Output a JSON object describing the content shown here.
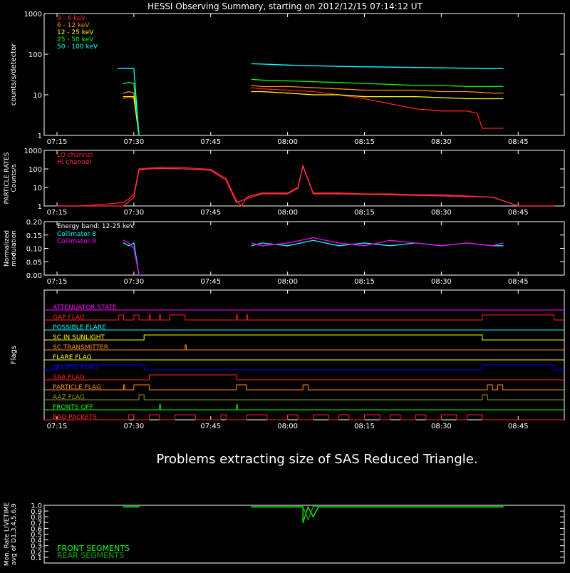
{
  "title": "HESSI Observing Summary, starting on 2012/12/15 07:14:12 UT",
  "time_ticks": [
    "07:15",
    "07:30",
    "07:45",
    "08:00",
    "08:15",
    "08:30",
    "08:45"
  ],
  "colors": {
    "band_3_6": "#ff2020",
    "band_6_12": "#ff8c00",
    "band_12_25": "#ffff00",
    "band_25_50": "#00ff00",
    "band_50_100": "#00ffff",
    "lo_channel": "#ff2020",
    "hi_channel": "#ff3050",
    "collimator_8": "#00ffff",
    "collimator_9": "#ff00ff",
    "front": "#00ff00",
    "rear": "#00aa00"
  },
  "message": "Problems extracting size of SAS Reduced Triangle.",
  "chart_data": [
    {
      "type": "line",
      "panel": "count-rates",
      "ylabel": "counts/s/detector",
      "yscale": "log",
      "ylim": [
        1,
        1000
      ],
      "y_ticks": [
        "1",
        "10",
        "100",
        "1000"
      ],
      "x_ticks": [
        "07:15",
        "07:30",
        "07:45",
        "08:00",
        "08:15",
        "08:30",
        "08:45"
      ],
      "legend": "top-left",
      "series": [
        {
          "name": "3 - 6 keV",
          "color": "#ff2020",
          "segments": [
            {
              "t": [
                "07:28",
                "07:29",
                "07:30",
                "07:31"
              ],
              "v": [
                8,
                9,
                8,
                1
              ]
            },
            {
              "t": [
                "07:53",
                "07:55",
                "08:00",
                "08:05",
                "08:10",
                "08:15",
                "08:20",
                "08:25",
                "08:30",
                "08:35",
                "08:37",
                "08:38",
                "08:42"
              ],
              "v": [
                15,
                14,
                13,
                12,
                10,
                8,
                6,
                4.5,
                4,
                4,
                3.5,
                1.5,
                1.5
              ]
            }
          ]
        },
        {
          "name": "6 - 12 keV",
          "color": "#ff8c00",
          "segments": [
            {
              "t": [
                "07:28",
                "07:29",
                "07:30",
                "07:31"
              ],
              "v": [
                11,
                12,
                11,
                1
              ]
            },
            {
              "t": [
                "07:53",
                "07:55",
                "08:00",
                "08:05",
                "08:10",
                "08:15",
                "08:20",
                "08:25",
                "08:30",
                "08:35",
                "08:40",
                "08:42"
              ],
              "v": [
                17,
                16,
                16,
                15,
                14,
                13,
                13,
                13,
                12,
                12,
                11,
                11
              ]
            }
          ]
        },
        {
          "name": "12 - 25 keV",
          "color": "#ffff00",
          "segments": [
            {
              "t": [
                "07:28",
                "07:29",
                "07:30",
                "07:31"
              ],
              "v": [
                9,
                9,
                9,
                1
              ]
            },
            {
              "t": [
                "07:53",
                "07:55",
                "08:00",
                "08:05",
                "08:10",
                "08:15",
                "08:20",
                "08:25",
                "08:30",
                "08:35",
                "08:40",
                "08:42"
              ],
              "v": [
                12,
                12,
                11,
                10,
                10,
                9,
                9,
                9,
                8.5,
                8,
                8,
                8
              ]
            }
          ]
        },
        {
          "name": "25 - 50 keV",
          "color": "#00ff00",
          "segments": [
            {
              "t": [
                "07:28",
                "07:29",
                "07:30",
                "07:31"
              ],
              "v": [
                19,
                20,
                19,
                1
              ]
            },
            {
              "t": [
                "07:53",
                "07:55",
                "08:00",
                "08:05",
                "08:10",
                "08:15",
                "08:20",
                "08:25",
                "08:30",
                "08:35",
                "08:40",
                "08:42"
              ],
              "v": [
                24,
                23,
                22,
                21,
                20,
                19,
                18,
                17,
                17,
                16,
                16,
                16
              ]
            }
          ]
        },
        {
          "name": "50 - 100 keV",
          "color": "#00ffff",
          "segments": [
            {
              "t": [
                "07:27",
                "07:28",
                "07:30",
                "07:31"
              ],
              "v": [
                44,
                45,
                44,
                1
              ]
            },
            {
              "t": [
                "07:53",
                "07:55",
                "08:00",
                "08:05",
                "08:10",
                "08:15",
                "08:20",
                "08:25",
                "08:30",
                "08:35",
                "08:40",
                "08:42"
              ],
              "v": [
                58,
                57,
                54,
                52,
                50,
                49,
                48,
                47,
                46,
                45,
                44,
                44
              ]
            }
          ]
        }
      ]
    },
    {
      "type": "line",
      "panel": "particle-rates",
      "ylabel": "PARTICLE RATES Counts/s",
      "yscale": "log",
      "ylim": [
        1,
        1000
      ],
      "y_ticks": [
        "1",
        "10",
        "100",
        "1000"
      ],
      "x_ticks": [
        "07:15",
        "07:30",
        "07:45",
        "08:00",
        "08:15",
        "08:30",
        "08:45"
      ],
      "legend": "top-left",
      "series": [
        {
          "name": "LO channel",
          "color": "#ff2020",
          "t": [
            "07:15",
            "07:20",
            "07:28",
            "07:30",
            "07:31",
            "07:33",
            "07:35",
            "07:40",
            "07:45",
            "07:48",
            "07:50",
            "07:51",
            "07:52",
            "07:55",
            "08:00",
            "08:02",
            "08:03",
            "08:05",
            "08:10",
            "08:15",
            "08:20",
            "08:25",
            "08:30",
            "08:35",
            "08:40",
            "08:45",
            "08:52"
          ],
          "v": [
            1,
            1,
            1.5,
            4,
            100,
            110,
            120,
            115,
            95,
            30,
            2,
            1,
            3,
            5,
            5,
            10,
            150,
            5,
            5,
            4.5,
            4.5,
            4,
            4,
            3.5,
            3,
            1,
            1
          ]
        },
        {
          "name": "HI channel",
          "color": "#ff3050",
          "t": [
            "07:15",
            "07:28",
            "07:30",
            "07:31",
            "07:33",
            "07:35",
            "07:40",
            "07:45",
            "07:48",
            "07:50",
            "07:52",
            "07:55",
            "08:00",
            "08:02",
            "08:03",
            "08:05",
            "08:10",
            "08:20",
            "08:30",
            "08:40",
            "08:45",
            "08:52"
          ],
          "v": [
            1,
            1,
            3,
            90,
            100,
            105,
            100,
            85,
            25,
            1.5,
            2.5,
            4.5,
            4.5,
            9,
            140,
            4.5,
            4.5,
            4,
            3.5,
            3,
            1,
            1
          ]
        }
      ]
    },
    {
      "type": "line",
      "panel": "modulation",
      "ylabel": "Normalized modulation",
      "annotation": "Energy band: 12-25 keV",
      "ylim": [
        0,
        0.2
      ],
      "y_ticks": [
        "0.00",
        "0.05",
        "0.10",
        "0.15",
        "0.20"
      ],
      "x_ticks": [
        "07:15",
        "07:30",
        "07:45",
        "08:00",
        "08:15",
        "08:30",
        "08:45"
      ],
      "legend": "top-left",
      "series": [
        {
          "name": "Collimator 8",
          "color": "#00ffff",
          "segments": [
            {
              "t": [
                "07:28",
                "07:29",
                "07:30",
                "07:31"
              ],
              "v": [
                0.12,
                0.11,
                0.12,
                0.0
              ]
            },
            {
              "t": [
                "07:53",
                "07:55",
                "08:00",
                "08:05",
                "08:10",
                "08:15",
                "08:20",
                "08:25",
                "08:30",
                "08:35",
                "08:40",
                "08:42"
              ],
              "v": [
                0.11,
                0.12,
                0.11,
                0.13,
                0.11,
                0.12,
                0.11,
                0.12,
                0.11,
                0.12,
                0.11,
                0.11
              ]
            }
          ]
        },
        {
          "name": "Collimator 9",
          "color": "#ff00ff",
          "segments": [
            {
              "t": [
                "07:28",
                "07:29",
                "07:30",
                "07:31"
              ],
              "v": [
                0.13,
                0.12,
                0.1,
                0.0
              ]
            },
            {
              "t": [
                "07:53",
                "07:55",
                "08:00",
                "08:05",
                "08:10",
                "08:15",
                "08:20",
                "08:25",
                "08:30",
                "08:35",
                "08:40",
                "08:42"
              ],
              "v": [
                0.12,
                0.11,
                0.12,
                0.14,
                0.12,
                0.11,
                0.13,
                0.12,
                0.11,
                0.12,
                0.11,
                0.12
              ]
            }
          ]
        }
      ]
    },
    {
      "type": "line",
      "panel": "flags",
      "ylabel": "Flags",
      "x_ticks": [
        "07:15",
        "07:30",
        "07:45",
        "08:00",
        "08:15",
        "08:30",
        "08:45"
      ],
      "series": [
        {
          "name": "ATTENUATOR STATE",
          "color": "#ff00ff",
          "on": []
        },
        {
          "name": "GAP FLAG",
          "color": "#ff2020",
          "on": [
            [
              "07:27",
              "07:28"
            ],
            [
              "07:30",
              "07:31"
            ],
            [
              "07:33",
              "07:33"
            ],
            [
              "07:35",
              "07:35"
            ],
            [
              "07:37",
              "07:40"
            ],
            [
              "07:50",
              "07:50"
            ],
            [
              "07:52",
              "07:52"
            ],
            [
              "08:38",
              "08:52"
            ]
          ]
        },
        {
          "name": "POSSIBLE FLARE",
          "color": "#00ffff",
          "on": []
        },
        {
          "name": "SC IN SUNLIGHT",
          "color": "#ffff00",
          "on": [
            [
              "07:32",
              "08:38"
            ]
          ]
        },
        {
          "name": "SC TRANSMITTER",
          "color": "#ff8c00",
          "on": [
            [
              "07:40",
              "07:40"
            ]
          ]
        },
        {
          "name": "FLARE FLAG",
          "color": "#ffff00",
          "on": []
        },
        {
          "name": "ECLIPSE FLAG",
          "color": "#0000ff",
          "on": [
            [
              "07:15",
              "07:32"
            ],
            [
              "08:38",
              "08:52"
            ]
          ]
        },
        {
          "name": "SAA FLAG",
          "color": "#ff2020",
          "on": [
            [
              "07:33",
              "07:50"
            ]
          ]
        },
        {
          "name": "PARTICLE FLAG",
          "color": "#ff8c00",
          "on": [
            [
              "07:28",
              "07:28"
            ],
            [
              "07:30",
              "07:33"
            ],
            [
              "07:50",
              "07:52"
            ],
            [
              "08:03",
              "08:04"
            ],
            [
              "08:39",
              "08:40"
            ],
            [
              "08:41",
              "08:42"
            ]
          ]
        },
        {
          "name": "AAZ FLAG",
          "color": "#999900",
          "on": [
            [
              "07:31",
              "07:32"
            ],
            [
              "08:38",
              "08:39"
            ]
          ]
        },
        {
          "name": "FRONTS OFF",
          "color": "#00ff00",
          "on": [
            [
              "07:35",
              "07:35"
            ],
            [
              "07:50",
              "07:50"
            ]
          ]
        },
        {
          "name": "BAD PACKETS",
          "color": "#ff2020",
          "on": [
            [
              "07:29",
              "07:30"
            ],
            [
              "07:33",
              "07:35"
            ],
            [
              "07:38",
              "07:42"
            ],
            [
              "07:47",
              "07:48"
            ],
            [
              "07:52",
              "07:56"
            ],
            [
              "08:00",
              "08:02"
            ],
            [
              "08:05",
              "08:08"
            ],
            [
              "08:10",
              "08:12"
            ],
            [
              "08:15",
              "08:18"
            ],
            [
              "08:20",
              "08:22"
            ],
            [
              "08:25",
              "08:27"
            ],
            [
              "08:30",
              "08:33"
            ],
            [
              "08:35",
              "08:38"
            ]
          ]
        }
      ]
    },
    {
      "type": "line",
      "panel": "livetime",
      "ylabel": "Mon. Rate LIVETIME avg of D1,3,4,5,6,9",
      "ylim": [
        0,
        1.0
      ],
      "y_ticks": [
        "0.1",
        "0.2",
        "0.3",
        "0.4",
        "0.5",
        "0.6",
        "0.7",
        "0.8",
        "0.9",
        "1.0"
      ],
      "legend": "bottom-left",
      "series": [
        {
          "name": "FRONT SEGMENTS",
          "color": "#00ff00",
          "segments": [
            {
              "t": [
                "07:28",
                "07:30",
                "07:31"
              ],
              "v": [
                0.97,
                0.97,
                0.97
              ]
            },
            {
              "t": [
                "07:53",
                "08:03",
                "08:03",
                "08:04",
                "08:05",
                "08:06",
                "08:10",
                "08:42"
              ],
              "v": [
                0.97,
                0.97,
                0.7,
                0.97,
                0.8,
                0.97,
                0.97,
                0.97
              ]
            }
          ]
        },
        {
          "name": "REAR SEGMENTS",
          "color": "#00aa00",
          "segments": [
            {
              "t": [
                "07:28",
                "07:30",
                "07:31"
              ],
              "v": [
                0.98,
                0.98,
                0.98
              ]
            },
            {
              "t": [
                "07:53",
                "08:03",
                "08:04",
                "08:05",
                "08:10",
                "08:42"
              ],
              "v": [
                0.98,
                0.98,
                0.75,
                0.98,
                0.98,
                0.98
              ]
            }
          ]
        }
      ]
    }
  ]
}
